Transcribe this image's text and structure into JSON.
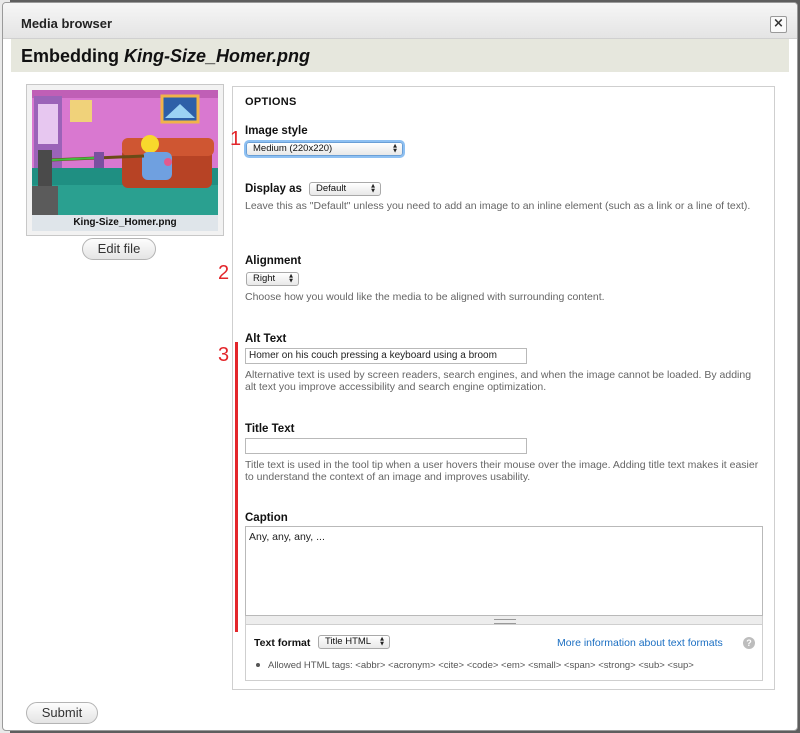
{
  "dialog": {
    "title": "Media browser",
    "close_glyph": "×",
    "heading_prefix": "Embedding",
    "heading_file": "King-Size_Homer.png"
  },
  "preview": {
    "filename": "King-Size_Homer.png",
    "edit_label": "Edit file"
  },
  "options": {
    "legend": "OPTIONS",
    "image_style": {
      "label": "Image style",
      "selected": "Medium (220x220)"
    },
    "display_as": {
      "label": "Display as",
      "selected": "Default",
      "description": "Leave this as \"Default\" unless you need to add an image to an inline element (such as a link or a line of text)."
    },
    "alignment": {
      "label": "Alignment",
      "selected": "Right",
      "description": "Choose how you would like the media to be aligned with surrounding content."
    },
    "alt_text": {
      "label": "Alt Text",
      "value": "Homer on his couch pressing a keyboard using a broom",
      "description": "Alternative text is used by screen readers, search engines, and when the image cannot be loaded. By adding alt text you improve accessibility and search engine optimization."
    },
    "title_text": {
      "label": "Title Text",
      "value": "",
      "description": "Title text is used in the tool tip when a user hovers their mouse over the image. Adding title text makes it easier to understand the context of an image and improves usability."
    },
    "caption": {
      "label": "Caption",
      "value": "Any, any, any, ..."
    },
    "text_format": {
      "label": "Text format",
      "selected": "Title HTML",
      "more_link": "More information about text formats",
      "help_glyph": "?",
      "allowed": "Allowed HTML tags: <abbr> <acronym> <cite> <code> <em> <small> <span> <strong> <sub> <sup>"
    }
  },
  "annotations": {
    "one": "1",
    "two": "2",
    "three": "3"
  },
  "submit_label": "Submit",
  "colors": {
    "annotation": "#e3262b",
    "link": "#1a6ec2",
    "header_band": "#e6e7dd"
  }
}
